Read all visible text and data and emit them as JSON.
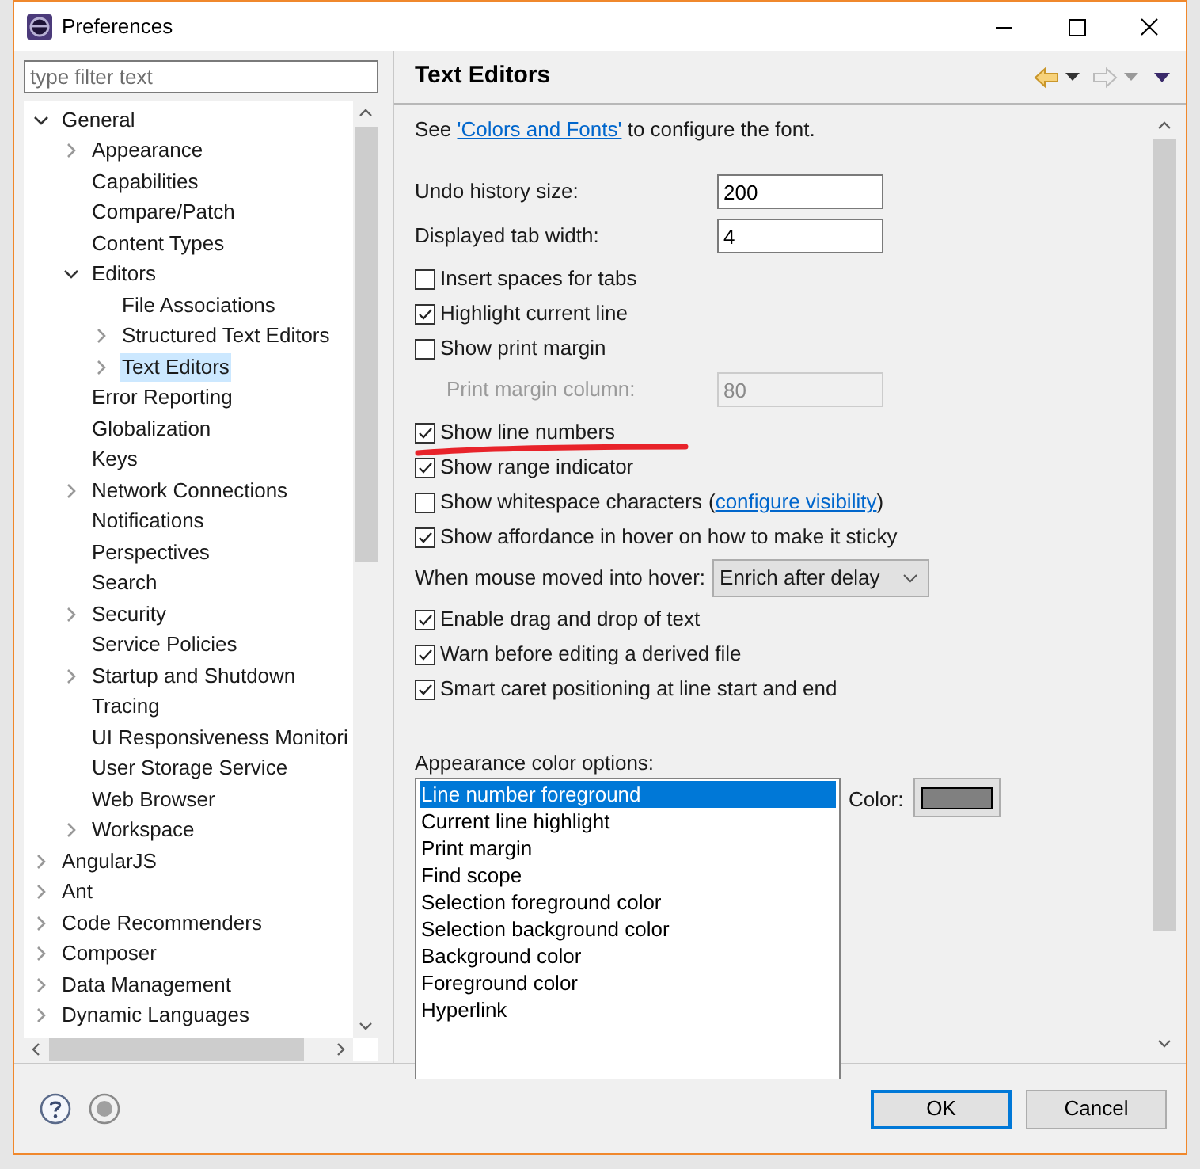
{
  "window": {
    "title": "Preferences"
  },
  "filter": {
    "placeholder": "type filter text"
  },
  "tree": [
    {
      "label": "General",
      "expandable": true,
      "expanded": true,
      "selected": false,
      "children": [
        {
          "label": "Appearance",
          "expandable": true,
          "expanded": false,
          "selected": false
        },
        {
          "label": "Capabilities",
          "expandable": false,
          "selected": false
        },
        {
          "label": "Compare/Patch",
          "expandable": false,
          "selected": false
        },
        {
          "label": "Content Types",
          "expandable": false,
          "selected": false
        },
        {
          "label": "Editors",
          "expandable": true,
          "expanded": true,
          "selected": false,
          "children": [
            {
              "label": "File Associations",
              "expandable": false,
              "selected": false
            },
            {
              "label": "Structured Text Editors",
              "expandable": true,
              "expanded": false,
              "selected": false
            },
            {
              "label": "Text Editors",
              "expandable": true,
              "expanded": false,
              "selected": true
            }
          ]
        },
        {
          "label": "Error Reporting",
          "expandable": false,
          "selected": false
        },
        {
          "label": "Globalization",
          "expandable": false,
          "selected": false
        },
        {
          "label": "Keys",
          "expandable": false,
          "selected": false
        },
        {
          "label": "Network Connections",
          "expandable": true,
          "expanded": false,
          "selected": false
        },
        {
          "label": "Notifications",
          "expandable": false,
          "selected": false
        },
        {
          "label": "Perspectives",
          "expandable": false,
          "selected": false
        },
        {
          "label": "Search",
          "expandable": false,
          "selected": false
        },
        {
          "label": "Security",
          "expandable": true,
          "expanded": false,
          "selected": false
        },
        {
          "label": "Service Policies",
          "expandable": false,
          "selected": false
        },
        {
          "label": "Startup and Shutdown",
          "expandable": true,
          "expanded": false,
          "selected": false
        },
        {
          "label": "Tracing",
          "expandable": false,
          "selected": false
        },
        {
          "label": "UI Responsiveness Monitori",
          "expandable": false,
          "selected": false
        },
        {
          "label": "User Storage Service",
          "expandable": false,
          "selected": false
        },
        {
          "label": "Web Browser",
          "expandable": false,
          "selected": false
        },
        {
          "label": "Workspace",
          "expandable": true,
          "expanded": false,
          "selected": false
        }
      ]
    },
    {
      "label": "AngularJS",
      "expandable": true,
      "expanded": false,
      "selected": false
    },
    {
      "label": "Ant",
      "expandable": true,
      "expanded": false,
      "selected": false
    },
    {
      "label": "Code Recommenders",
      "expandable": true,
      "expanded": false,
      "selected": false
    },
    {
      "label": "Composer",
      "expandable": true,
      "expanded": false,
      "selected": false
    },
    {
      "label": "Data Management",
      "expandable": true,
      "expanded": false,
      "selected": false
    },
    {
      "label": "Dynamic Languages",
      "expandable": true,
      "expanded": false,
      "selected": false
    }
  ],
  "page": {
    "title": "Text Editors",
    "content": [
      {
        "kind": "note",
        "before": "See ",
        "link": "'Colors and Fonts'",
        "after": " to configure the font."
      },
      {
        "kind": "field",
        "label": "Undo history size:",
        "value": "200",
        "disabled": false
      },
      {
        "kind": "field",
        "label": "Displayed tab width:",
        "value": "4",
        "disabled": false
      },
      {
        "kind": "checkbox",
        "label": "Insert spaces for tabs",
        "checked": false
      },
      {
        "kind": "checkbox",
        "label": "Highlight current line",
        "checked": true
      },
      {
        "kind": "checkbox",
        "label": "Show print margin",
        "checked": false
      },
      {
        "kind": "field",
        "label": "Print margin column:",
        "value": "80",
        "disabled": true
      },
      {
        "kind": "checkbox",
        "label": "Show line numbers",
        "checked": true,
        "underlined": true
      },
      {
        "kind": "checkbox",
        "label": "Show range indicator",
        "checked": true
      },
      {
        "kind": "checkbox",
        "label": "Show whitespace characters",
        "checked": false,
        "link_before": "(",
        "link": "configure visibility",
        "link_after": ")"
      },
      {
        "kind": "checkbox",
        "label": "Show affordance in hover on how to make it sticky",
        "checked": true
      },
      {
        "kind": "dropdown",
        "label": "When mouse moved into hover:",
        "value": "Enrich after delay"
      },
      {
        "kind": "checkbox",
        "label": "Enable drag and drop of text",
        "checked": true
      },
      {
        "kind": "checkbox",
        "label": "Warn before editing a derived file",
        "checked": true
      },
      {
        "kind": "checkbox",
        "label": "Smart caret positioning at line start and end",
        "checked": true
      }
    ],
    "color_options": {
      "label": "Appearance color options:",
      "items": [
        {
          "label": "Line number foreground",
          "selected": true
        },
        {
          "label": "Current line highlight",
          "selected": false
        },
        {
          "label": "Print margin",
          "selected": false
        },
        {
          "label": "Find scope",
          "selected": false
        },
        {
          "label": "Selection foreground color",
          "selected": false
        },
        {
          "label": "Selection background color",
          "selected": false
        },
        {
          "label": "Background color",
          "selected": false
        },
        {
          "label": "Foreground color",
          "selected": false
        },
        {
          "label": "Hyperlink",
          "selected": false
        }
      ],
      "color_label": "Color:",
      "color": "#808080"
    }
  },
  "buttons": [
    {
      "label": "OK",
      "default": true
    },
    {
      "label": "Cancel",
      "default": false
    }
  ]
}
